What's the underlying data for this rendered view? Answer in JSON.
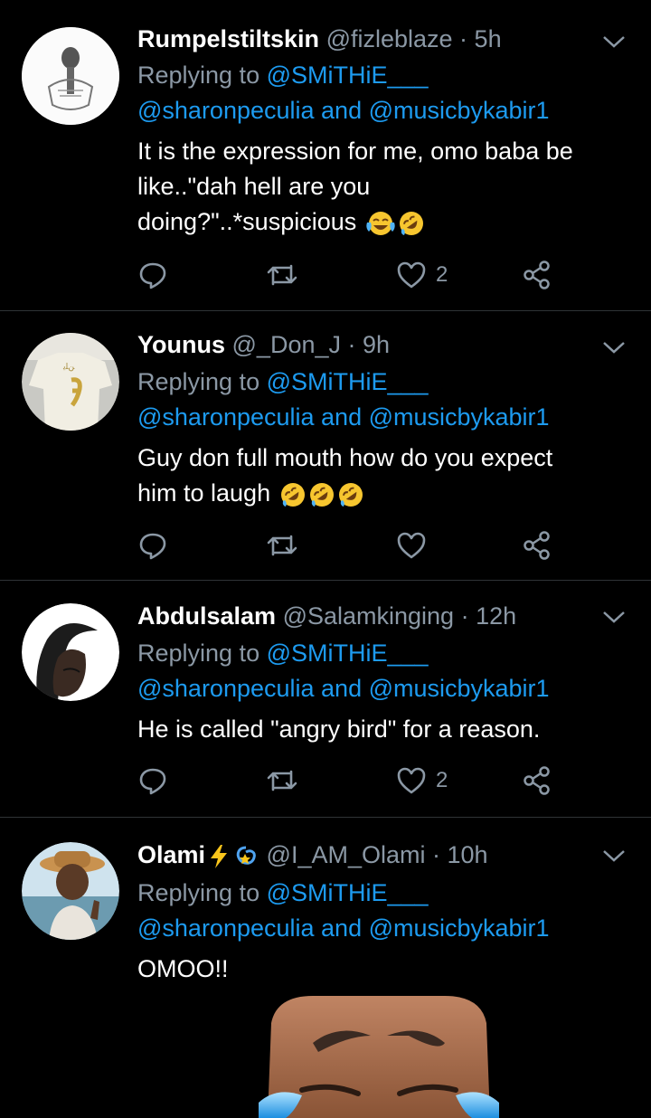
{
  "tweets": [
    {
      "name": "Rumpelstiltskin",
      "handle": "@fizleblaze",
      "time": "5h",
      "replying_prefix": "Replying to ",
      "replying_to": "@SMiTHiE___",
      "mention_a": "@sharonpeculia",
      "and": " and ",
      "mention_b": "@musicbykabir1",
      "text_lines": [
        "It is the expression for me, omo baba be",
        "like..\"dah hell are you",
        "doing?\"..*suspicious"
      ],
      "like_count": "2"
    },
    {
      "name": "Younus",
      "handle": "@_Don_J",
      "time": "9h",
      "replying_prefix": "Replying to ",
      "replying_to": "@SMiTHiE___",
      "mention_a": "@sharonpeculia",
      "and": " and ",
      "mention_b": "@musicbykabir1",
      "text_lines": [
        "Guy don full mouth how do you expect",
        "him to laugh"
      ],
      "like_count": ""
    },
    {
      "name": "Abdulsalam",
      "handle": "@Salamkinging",
      "time": "12h",
      "replying_prefix": "Replying to ",
      "replying_to": "@SMiTHiE___",
      "mention_a": "@sharonpeculia",
      "and": " and ",
      "mention_b": "@musicbykabir1",
      "text_lines": [
        "He is called \"angry bird\" for a reason."
      ],
      "like_count": "2"
    },
    {
      "name": "Olami",
      "handle": "@I_AM_Olami",
      "time": "10h",
      "replying_prefix": "Replying to ",
      "replying_to": "@SMiTHiE___",
      "mention_a": "@sharonpeculia",
      "and": " and ",
      "mention_b": "@musicbykabir1",
      "text_lines": [
        "OMOO!!"
      ]
    }
  ],
  "dot": " · ",
  "icons": {
    "reply": "reply-icon",
    "retweet": "retweet-icon",
    "like": "heart-icon",
    "share": "share-icon",
    "menu": "chevron-down-icon",
    "laugh_emoji": "tears-of-joy-emoji",
    "rofl_emoji": "rolling-laughing-emoji",
    "lightning_emoji": "lightning-emoji",
    "dizzy_emoji": "dizzy-emoji"
  },
  "colors": {
    "link": "#1d9bf0",
    "muted": "#8b98a5",
    "background": "#000000"
  }
}
